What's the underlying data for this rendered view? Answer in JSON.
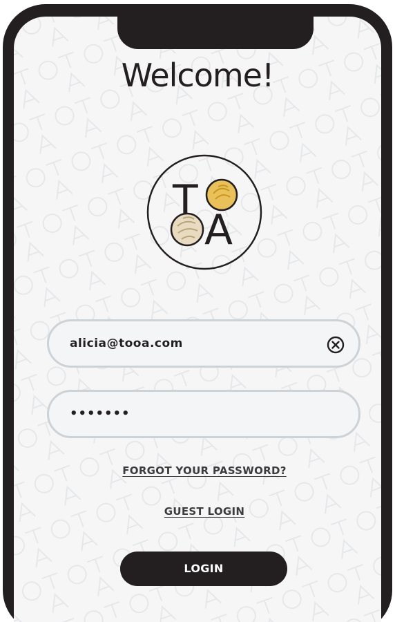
{
  "header": {
    "title": "Welcome!"
  },
  "logo": {
    "letters": [
      "T",
      "O",
      "O",
      "A"
    ],
    "icon": "tooa-logo"
  },
  "login_form": {
    "email_value": "alicia@tooa.com",
    "password_value": "•••••••",
    "clear_icon": "clear-circle-x-icon",
    "forgot_password_label": "FORGOT YOUR PASSWORD?",
    "guest_login_label": "GUEST LOGIN",
    "login_button_label": "LOGIN"
  },
  "colors": {
    "frame": "#231f20",
    "background": "#f6f6f7",
    "field_border": "#cdd2d6",
    "cookie_yellow": "#e9c05a",
    "cookie_cream": "#e8dbc0"
  }
}
